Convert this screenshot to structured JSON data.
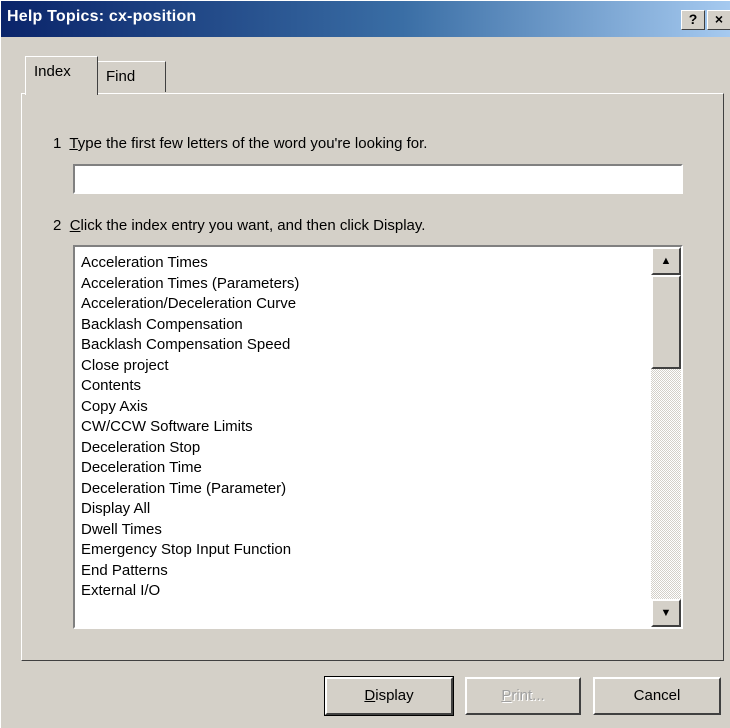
{
  "window": {
    "title": "Help Topics: cx-position",
    "help_button": "?",
    "close_button": "×"
  },
  "tabs": [
    {
      "label": "Index",
      "active": true
    },
    {
      "label": "Find",
      "active": false
    }
  ],
  "step1": {
    "number": "1",
    "mnemonic": "T",
    "rest": "ype the first few letters of the word you're looking for."
  },
  "search": {
    "value": "",
    "placeholder": ""
  },
  "step2": {
    "number": "2",
    "mnemonic": "C",
    "rest": "lick the index entry you want, and then click Display."
  },
  "index_entries": [
    "Acceleration Times",
    "Acceleration Times (Parameters)",
    "Acceleration/Deceleration Curve",
    "Backlash Compensation",
    "Backlash Compensation Speed",
    "Close project",
    "Contents",
    "Copy Axis",
    "CW/CCW Software Limits",
    "Deceleration Stop",
    "Deceleration Time",
    "Deceleration Time (Parameter)",
    "Display All",
    "Dwell Times",
    "Emergency Stop Input Function",
    "End Patterns",
    "External I/O"
  ],
  "buttons": {
    "display": {
      "mnemonic": "D",
      "rest": "isplay"
    },
    "print": {
      "mnemonic": "P",
      "rest": "rint..."
    },
    "cancel": "Cancel"
  },
  "scrollbar": {
    "up_arrow": "▲",
    "down_arrow": "▼"
  },
  "colors": {
    "title_bar_start": "#0a246a",
    "title_bar_end": "#a6caf0",
    "face": "#d4d0c8"
  }
}
